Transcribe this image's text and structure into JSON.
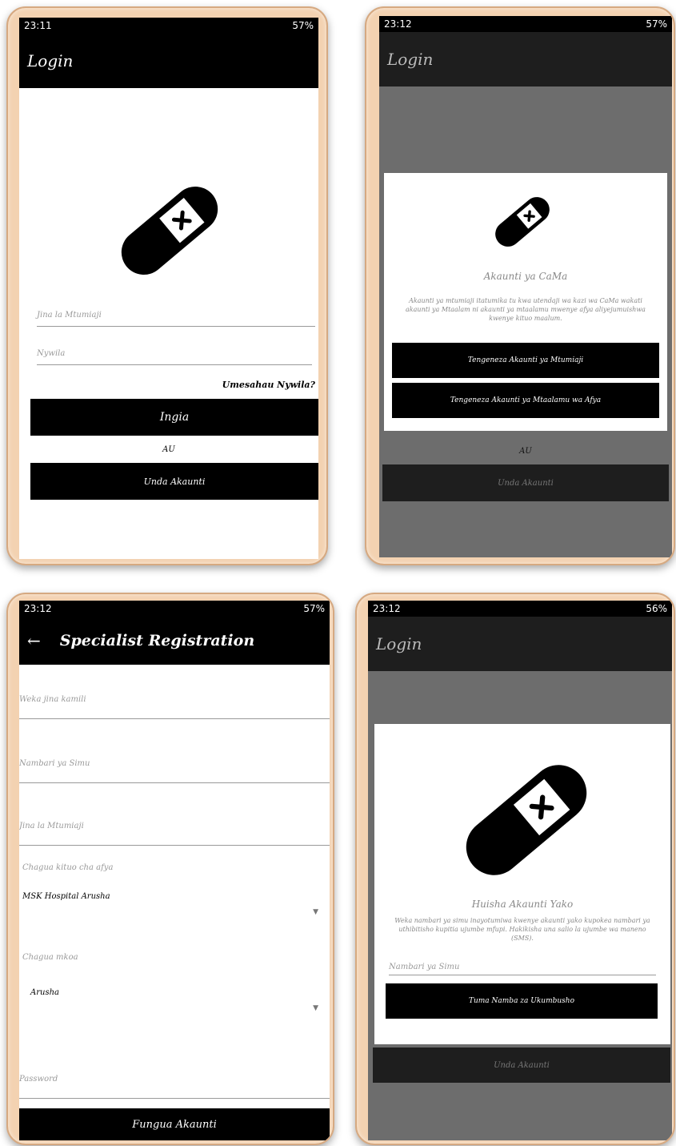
{
  "status": {
    "time_a": "23:11",
    "time_b": "23:12",
    "signal_a": "57%",
    "signal_b": "57%",
    "signal_c": "57%",
    "signal_d": "56%",
    "dots": "···"
  },
  "screen1": {
    "title": "Login",
    "username_placeholder": "Jina la Mtumiaji",
    "password_placeholder": "Nywila",
    "forgot": "Umesahau Nywila?",
    "login_button": "Ingia",
    "or": "AU",
    "create_button": "Unda Akaunti"
  },
  "screen2": {
    "title": "Login",
    "dialog_title": "Akaunti ya CaMa",
    "dialog_body": "Akaunti ya mtumiaji itatumika tu kwa utendaji wa kazi wa CaMa wakati akaunti ya Mtaalam ni akaunti ya mtaalamu mwenye afya aliyejumuishwa kwenye kituo maalum.",
    "btn_user": "Tengeneza Akaunti ya Mtumiaji",
    "btn_specialist": "Tengeneza Akaunti ya Mtaalamu wa Afya",
    "or": "AU",
    "create_button": "Unda Akaunti"
  },
  "screen3": {
    "title": "Specialist Registration",
    "back": "←",
    "fullname_placeholder": "Weka jina kamili",
    "phone_placeholder": "Nambari ya Simu",
    "username_placeholder": "Jina la Mtumiaji",
    "facility_label": "Chagua kituo cha afya",
    "facility_value": "MSK Hospital Arusha",
    "region_label": "Chagua mkoa",
    "region_value": "Arusha",
    "password_placeholder": "Password",
    "submit": "Fungua Akaunti"
  },
  "screen4": {
    "title": "Login",
    "dialog_title": "Huisha Akaunti Yako",
    "dialog_body": "Weka nambari ya simu inayotumiwa kwenye akaunti yako kupokea nambari ya uthibitisho kupitia ujumbe mfupi. Hakikisha una salio la ujumbe wa maneno (SMS).",
    "phone_placeholder": "Nambari ya Simu",
    "send_button": "Tuma Namba za Ukumbusho",
    "create_button": "Unda Akaunti"
  }
}
